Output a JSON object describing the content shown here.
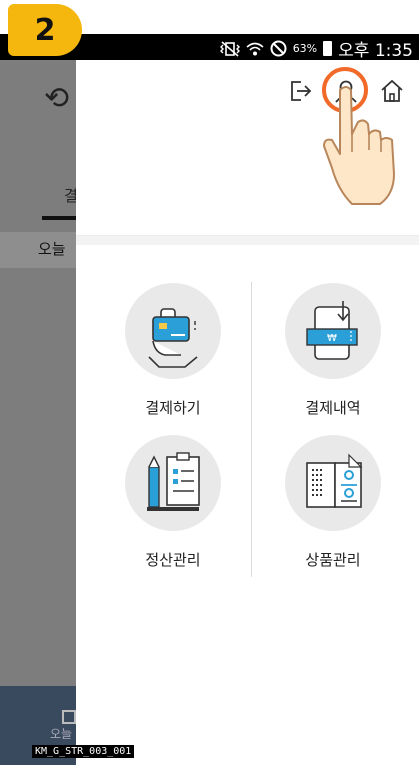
{
  "status_bar": {
    "battery": "63%",
    "time": "오후 1:35",
    "icons": [
      "mute-vibrate-icon",
      "wifi-icon",
      "no-sim-icon",
      "battery-icon"
    ]
  },
  "background_screen": {
    "tab_partial": "결",
    "today_partial": "오늘",
    "bottom_partial": "오늘"
  },
  "drawer": {
    "header_icons": [
      "logout-icon",
      "user-icon",
      "home-icon"
    ],
    "menu": [
      {
        "label": "결제하기",
        "icon": "card-payment-icon"
      },
      {
        "label": "결제내역",
        "icon": "payment-history-icon"
      },
      {
        "label": "정산관리",
        "icon": "settlement-icon"
      },
      {
        "label": "상품관리",
        "icon": "product-management-icon"
      }
    ]
  },
  "overlay": {
    "step_number": "2",
    "caption": "KM_G_STR_003_001"
  },
  "colors": {
    "badge": "#f5b70e",
    "highlight": "#f26a2a",
    "accent_blue": "#2a9fd8",
    "dim": "#7d7d7d"
  }
}
